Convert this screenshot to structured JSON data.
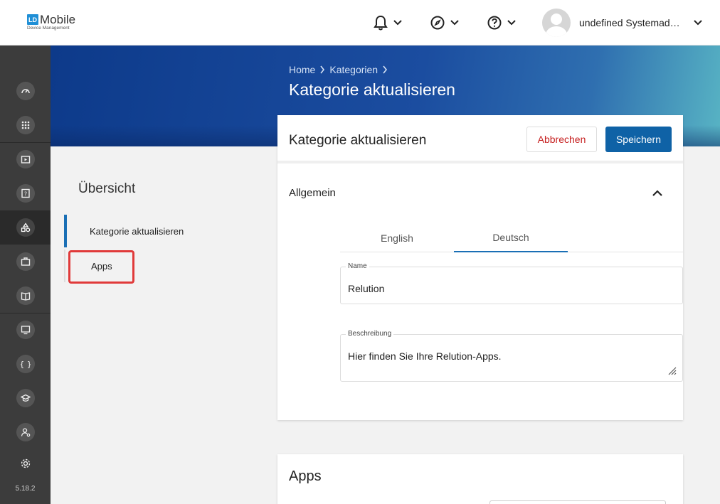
{
  "header": {
    "logo_mark": "LD",
    "logo_title": "Mobile",
    "logo_subtitle": "Device Management",
    "user_name": "undefined Systemadmi..."
  },
  "rail": {
    "version": "5.18.2",
    "icons": [
      "dashboard-icon",
      "apps-grid-icon",
      "media-icon",
      "help-doc-icon",
      "shapes-icon",
      "briefcase-icon",
      "book-icon",
      "device-settings-icon",
      "braces-icon",
      "education-icon",
      "user-settings-icon",
      "gear-icon"
    ]
  },
  "hero": {
    "breadcrumb": [
      "Home",
      "Kategorien"
    ],
    "title": "Kategorie aktualisieren"
  },
  "overview": {
    "title": "Übersicht",
    "items": [
      {
        "label": "Kategorie aktualisieren",
        "active": true
      },
      {
        "label": "Apps",
        "active": false
      }
    ]
  },
  "card": {
    "title": "Kategorie aktualisieren",
    "cancel_label": "Abbrechen",
    "save_label": "Speichern",
    "section_title": "Allgemein",
    "tabs": [
      {
        "label": "English",
        "active": false
      },
      {
        "label": "Deutsch",
        "active": true
      }
    ],
    "name_label": "Name",
    "name_value": "Relution",
    "desc_label": "Beschreibung",
    "desc_value": "Hier finden Sie Ihre Relution-Apps."
  },
  "apps_card": {
    "title": "Apps"
  },
  "colors": {
    "accent": "#0f62a6",
    "cancel": "#c62020",
    "highlight": "#e03a3a",
    "rail": "#3c3c3c"
  }
}
